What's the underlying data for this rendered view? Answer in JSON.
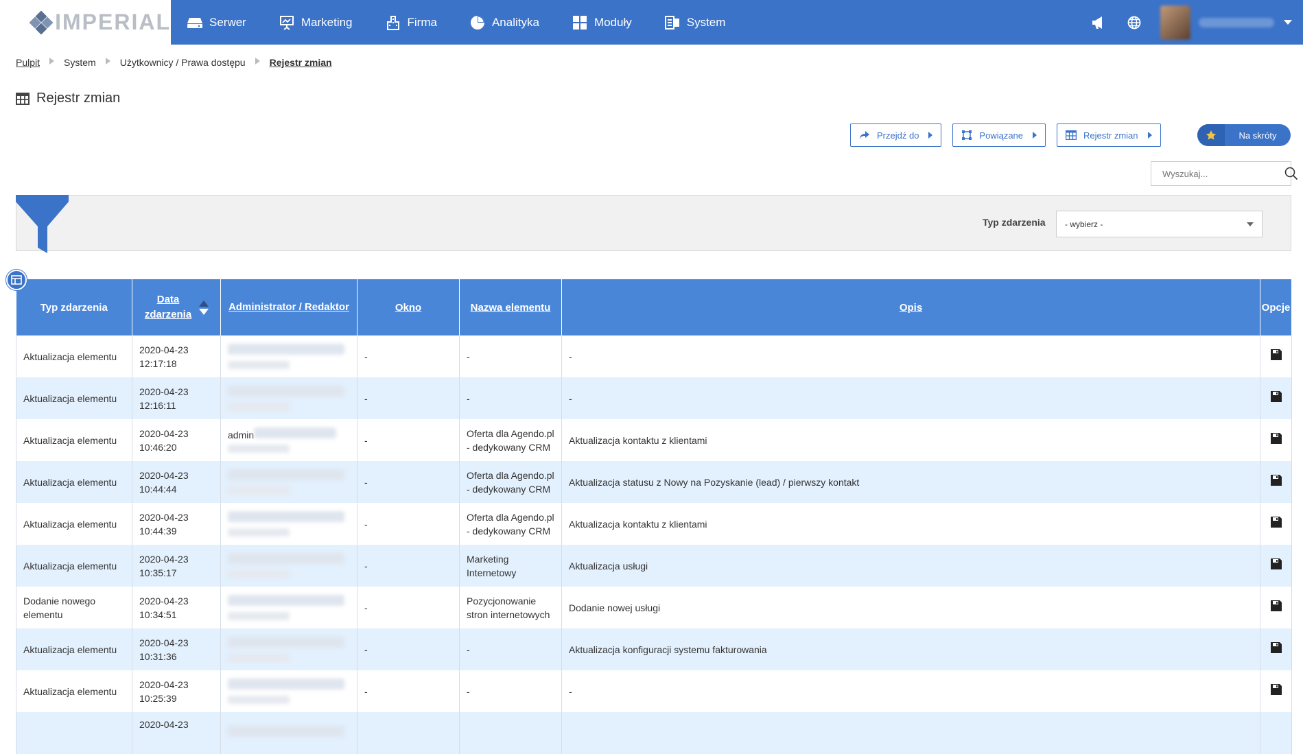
{
  "app": {
    "logo_text": "IMPERIAL"
  },
  "nav": [
    {
      "label": "Serwer",
      "icon": "server-icon"
    },
    {
      "label": "Marketing",
      "icon": "presentation-icon"
    },
    {
      "label": "Firma",
      "icon": "building-icon"
    },
    {
      "label": "Analityka",
      "icon": "pie-chart-icon"
    },
    {
      "label": "Moduły",
      "icon": "grid-icon"
    },
    {
      "label": "System",
      "icon": "system-icon"
    }
  ],
  "breadcrumb": [
    "Pulpit",
    "System",
    "Użytkownicy / Prawa dostępu",
    "Rejestr zmian"
  ],
  "page_title": "Rejestr zmian",
  "actions": [
    "Przejdź do",
    "Powiązane",
    "Rejestr zmian"
  ],
  "favorites_label": "Na skróty",
  "search": {
    "placeholder": "Wyszukaj..."
  },
  "filter": {
    "label": "Typ zdarzenia",
    "select_value": "- wybierz -"
  },
  "table": {
    "headers": {
      "type": "Typ zdarzenia",
      "date": "Data zdarzenia",
      "admin": "Administrator / Redaktor",
      "window": "Okno",
      "element": "Nazwa elementu",
      "desc": "Opis",
      "options": "Opcje"
    },
    "rows": [
      {
        "type": "Aktualizacja elementu",
        "date": "2020-04-23",
        "time": "12:17:18",
        "admin_prefix": "",
        "window": "-",
        "element": "-",
        "desc": "-"
      },
      {
        "type": "Aktualizacja elementu",
        "date": "2020-04-23",
        "time": "12:16:11",
        "admin_prefix": "",
        "window": "-",
        "element": "-",
        "desc": "-"
      },
      {
        "type": "Aktualizacja elementu",
        "date": "2020-04-23",
        "time": "10:46:20",
        "admin_prefix": "admin",
        "window": "-",
        "element": "Oferta dla Agendo.pl - dedykowany CRM",
        "desc": "Aktualizacja kontaktu z klientami"
      },
      {
        "type": "Aktualizacja elementu",
        "date": "2020-04-23",
        "time": "10:44:44",
        "admin_prefix": "",
        "window": "-",
        "element": "Oferta dla Agendo.pl - dedykowany CRM",
        "desc": "Aktualizacja statusu z Nowy na Pozyskanie (lead) / pierwszy kontakt"
      },
      {
        "type": "Aktualizacja elementu",
        "date": "2020-04-23",
        "time": "10:44:39",
        "admin_prefix": "",
        "window": "-",
        "element": "Oferta dla Agendo.pl - dedykowany CRM",
        "desc": "Aktualizacja kontaktu z klientami"
      },
      {
        "type": "Aktualizacja elementu",
        "date": "2020-04-23",
        "time": "10:35:17",
        "admin_prefix": "",
        "window": "-",
        "element": "Marketing Internetowy",
        "desc": "Aktualizacja usługi"
      },
      {
        "type": "Dodanie nowego elementu",
        "date": "2020-04-23",
        "time": "10:34:51",
        "admin_prefix": "",
        "window": "-",
        "element": "Pozycjonowanie stron internetowych",
        "desc": "Dodanie nowej usługi"
      },
      {
        "type": "Aktualizacja elementu",
        "date": "2020-04-23",
        "time": "10:31:36",
        "admin_prefix": "",
        "window": "-",
        "element": "-",
        "desc": "Aktualizacja konfiguracji systemu fakturowania"
      },
      {
        "type": "Aktualizacja elementu",
        "date": "2020-04-23",
        "time": "10:25:39",
        "admin_prefix": "",
        "window": "-",
        "element": "-",
        "desc": "-"
      },
      {
        "type": "",
        "date": "2020-04-23",
        "time": "",
        "admin_prefix": "",
        "window": "",
        "element": "",
        "desc": ""
      }
    ]
  },
  "colors": {
    "primary": "#3b73c9",
    "header": "#4a86d8",
    "row_alt": "#e3f0fd"
  }
}
